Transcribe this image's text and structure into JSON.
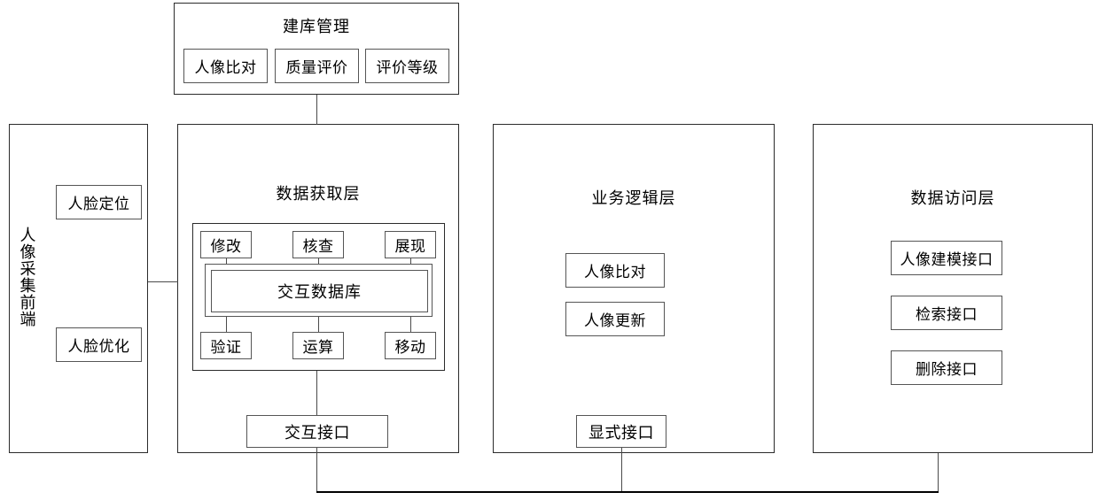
{
  "diagram": {
    "title_top": "建库管理",
    "top_module": {
      "label": "建库管理",
      "items": [
        {
          "label": "人像比对"
        },
        {
          "label": "质量评价"
        },
        {
          "label": "评价等级"
        }
      ]
    },
    "columns": [
      {
        "id": "capture-frontend",
        "label": "人像采集前端",
        "orientation": "vertical",
        "items": [
          {
            "label": "人脸定位"
          },
          {
            "label": "人脸优化"
          }
        ]
      },
      {
        "id": "data-acquisition-layer",
        "label": "数据获取层",
        "orientation": "horizontal",
        "inner_panel": {
          "top_row": [
            {
              "label": "修改"
            },
            {
              "label": "核查"
            },
            {
              "label": "展现"
            }
          ],
          "database": {
            "label": "交互数据库"
          },
          "bottom_row": [
            {
              "label": "验证"
            },
            {
              "label": "运算"
            },
            {
              "label": "移动"
            }
          ]
        },
        "interface": {
          "label": "交互接口"
        }
      },
      {
        "id": "business-logic-layer",
        "label": "业务逻辑层",
        "orientation": "horizontal",
        "items": [
          {
            "label": "人像比对"
          },
          {
            "label": "人像更新"
          }
        ],
        "interface": {
          "label": "显式接口"
        }
      },
      {
        "id": "data-access-layer",
        "label": "数据访问层",
        "orientation": "horizontal",
        "items": [
          {
            "label": "人像建模接口"
          },
          {
            "label": "检索接口"
          },
          {
            "label": "删除接口"
          }
        ]
      }
    ],
    "colors": {
      "background": "#ffffff",
      "stroke": "#3a3a3a",
      "bus": "#000000",
      "text": "#000000"
    }
  }
}
